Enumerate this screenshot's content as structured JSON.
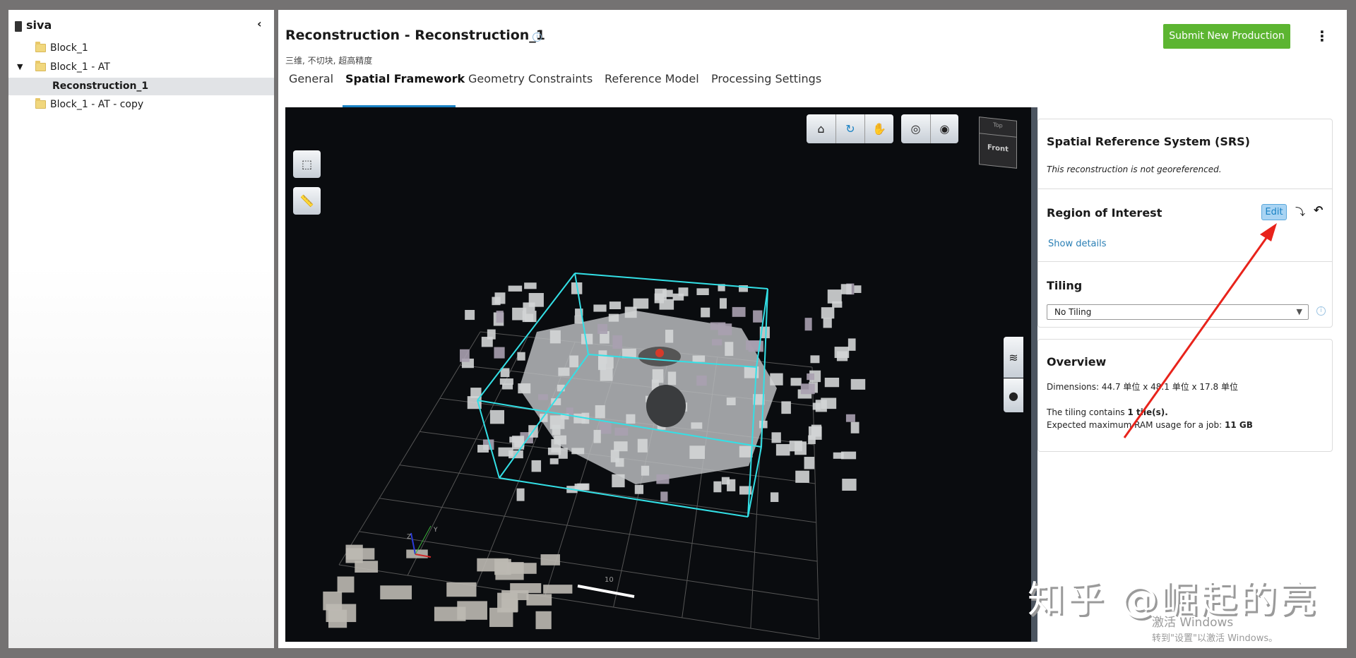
{
  "sidebar": {
    "root": "siva",
    "items": [
      {
        "label": "Block_1"
      },
      {
        "label": "Block_1 - AT",
        "expanded": true
      },
      {
        "label": "Reconstruction_1",
        "selected": true
      },
      {
        "label": "Block_1 - AT - copy"
      }
    ]
  },
  "header": {
    "title": "Reconstruction - Reconstruction_1",
    "subtitle": "三维, 不切块, 超高精度",
    "submit_label": "Submit New Production",
    "accent": "#5cb531"
  },
  "tabs": [
    {
      "label": "General"
    },
    {
      "label": "Spatial Framework",
      "active": true
    },
    {
      "label": "Geometry Constraints"
    },
    {
      "label": "Reference Model"
    },
    {
      "label": "Processing Settings"
    }
  ],
  "viewer": {
    "cube_top": "Top",
    "cube_front": "Front",
    "scale_label": "10",
    "axis_z": "Z",
    "axis_y": "Y",
    "toolbar": [
      "home-icon",
      "orbit-icon",
      "pan-icon",
      "focus-icon",
      "visibility-icon"
    ],
    "roi_box_color": "#33e0e6"
  },
  "srs": {
    "title": "Spatial Reference System (SRS)",
    "text": "This reconstruction is not georeferenced."
  },
  "roi": {
    "title": "Region of Interest",
    "edit_label": "Edit",
    "show_details": "Show details"
  },
  "tiling": {
    "title": "Tiling",
    "selected": "No Tiling"
  },
  "overview": {
    "title": "Overview",
    "dimensions": "Dimensions: 44.7 单位 x 48.1 单位 x 17.8 单位",
    "tiling_prefix": "The tiling contains ",
    "tiling_count": "1 tile(s).",
    "ram_prefix": "Expected maximum RAM usage for a job: ",
    "ram_value": "11 GB"
  },
  "watermark": {
    "zhihu": "知乎 @崛起的亮",
    "activate": "激活 Windows",
    "activate_sub": "转到\"设置\"以激活 Windows。"
  }
}
